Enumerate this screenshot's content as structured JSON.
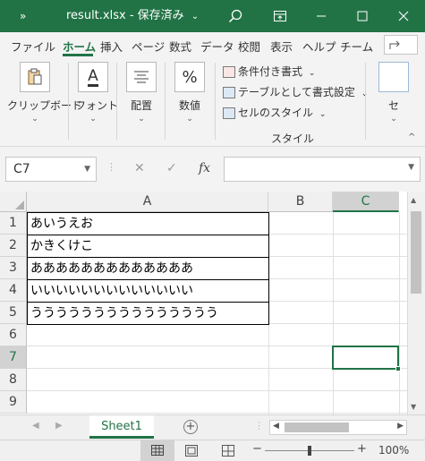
{
  "titlebar": {
    "qat_symbol": "»",
    "title": "result.xlsx - 保存済み",
    "title_chevron": "⌄",
    "search_icon": "search-icon",
    "colors": {
      "bar": "#217346",
      "text": "#ffffff"
    }
  },
  "tabs": [
    {
      "label": "ファイル"
    },
    {
      "label": "ホーム",
      "active": true
    },
    {
      "label": "挿入"
    },
    {
      "label": "ページ"
    },
    {
      "label": "数式"
    },
    {
      "label": "データ"
    },
    {
      "label": "校閲"
    },
    {
      "label": "表示"
    },
    {
      "label": "ヘルプ"
    },
    {
      "label": "チーム"
    }
  ],
  "ribbon": {
    "clipboard": {
      "label": "クリップボード",
      "icon": "clipboard-icon"
    },
    "font": {
      "label": "フォント",
      "icon": "font-icon",
      "glyph": "A"
    },
    "alignment": {
      "label": "配置",
      "icon": "align-icon"
    },
    "number": {
      "label": "数値",
      "icon": "percent-icon",
      "glyph": "%"
    },
    "styles": {
      "conditional": "条件付き書式",
      "table": "テーブルとして書式設定",
      "cell_styles": "セルのスタイル",
      "group_label": "スタイル"
    },
    "cells": {
      "label": "セ"
    },
    "chevron": "⌄",
    "collapse_icon": "^"
  },
  "formula": {
    "namebox": "C7",
    "cancel_glyph": "✕",
    "enter_glyph": "✓",
    "fx_glyph": "fx",
    "value": ""
  },
  "sheet": {
    "columns": [
      "A",
      "B",
      "C"
    ],
    "selected_column": "C",
    "rows": [
      "1",
      "2",
      "3",
      "4",
      "5",
      "6",
      "7",
      "8",
      "9"
    ],
    "selected_row": "7",
    "cells_a": [
      "あいうえお",
      "かきくけこ",
      "あああああああああああああ",
      "いいいいいいいいいいいいい",
      "ううううううううううううううう"
    ],
    "active_cell": "C7"
  },
  "sheetbar": {
    "tab": "Sheet1",
    "add_symbol": "+"
  },
  "statusbar": {
    "zoom": "100%",
    "minus": "−",
    "plus": "+",
    "zoom_level": 0.5
  }
}
